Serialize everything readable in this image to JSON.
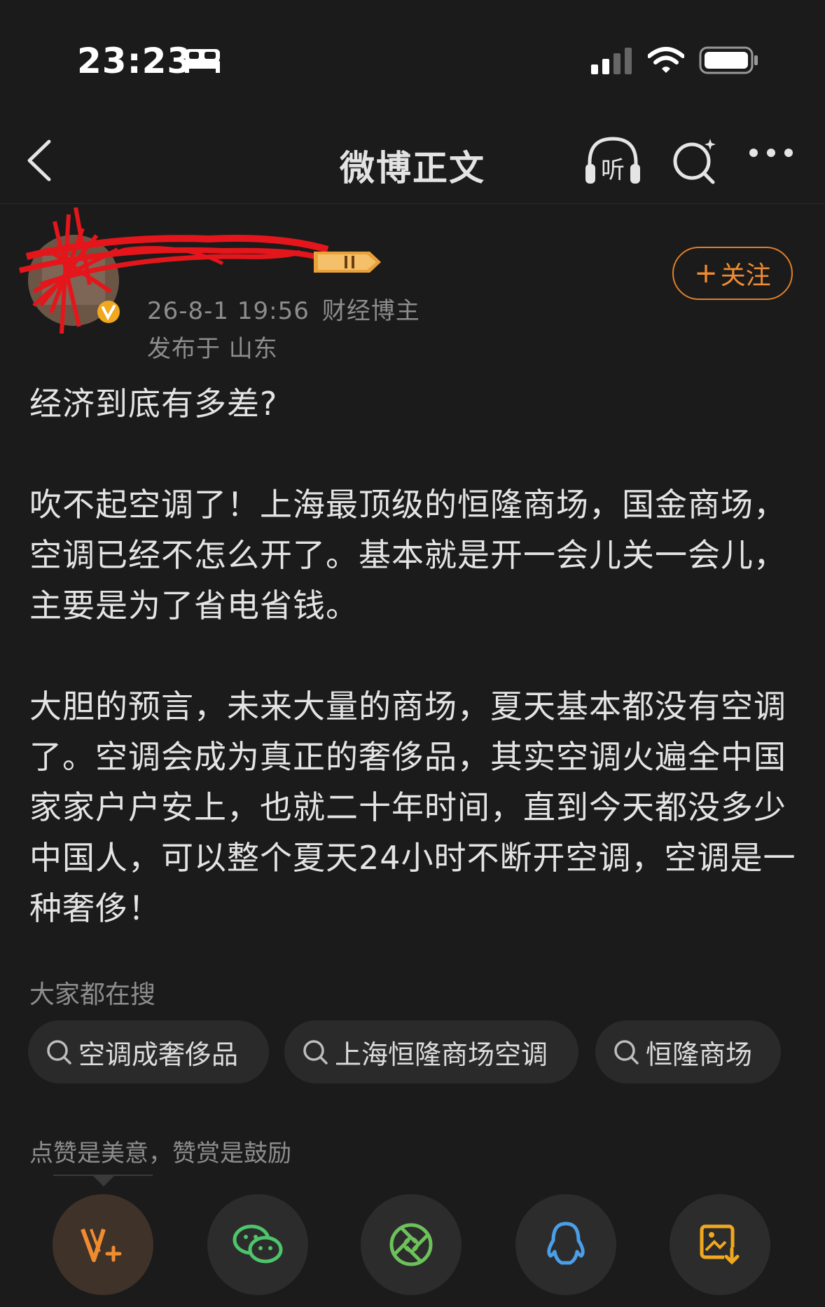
{
  "status_bar": {
    "time": "23:23",
    "icons": [
      "bed-icon",
      "signal-icon",
      "wifi-icon",
      "battery-icon"
    ]
  },
  "nav": {
    "title": "微博正文",
    "listen_label": "听",
    "icons": [
      "back-icon",
      "listen-icon",
      "search-icon",
      "more-icon"
    ]
  },
  "author": {
    "meta_time": "26-8-1 19:56",
    "meta_role": "财经博主",
    "location": "发布于 山东",
    "follow_label": "关注"
  },
  "post": {
    "line1": "经济到底有多差?",
    "para2": "吹不起空调了！上海最顶级的恒隆商场，国金商场，空调已经不怎么开了。基本就是开一会儿关一会儿，主要是为了省电省钱。",
    "para3": "大胆的预言，未来大量的商场，夏天基本都没有空调了。空调会成为真正的奢侈品，其实空调火遍全中国家家户户安上，也就二十年时间，直到今天都没多少中国人，可以整个夏天24小时不断开空调，空调是一种奢侈！"
  },
  "trending": {
    "label": "大家都在搜",
    "items": [
      "空调成奢侈品",
      "上海恒隆商场空调",
      "恒隆商场"
    ]
  },
  "reward": {
    "label": "点赞是美意，赞赏是鼓励"
  },
  "share": {
    "icons": [
      "reward-v-icon",
      "wechat-icon",
      "moments-icon",
      "qq-icon",
      "save-image-icon"
    ]
  },
  "colors": {
    "background": "#1b1b1b",
    "accent": "#f08c30",
    "secondary_text": "#8d8d8d"
  }
}
